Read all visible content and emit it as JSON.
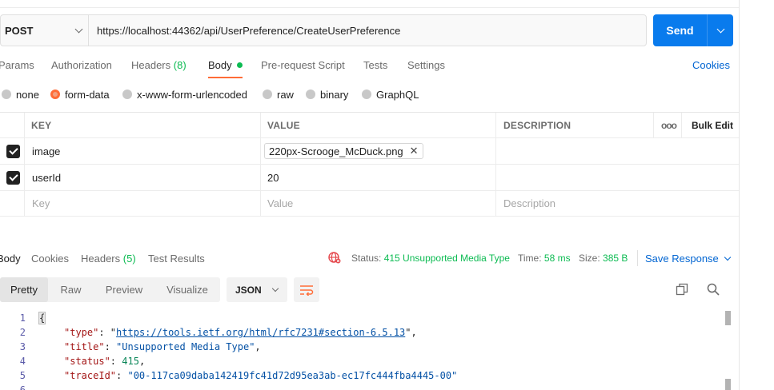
{
  "request": {
    "method": "POST",
    "url": "https://localhost:44362/api/UserPreference/CreateUserPreference",
    "send_label": "Send"
  },
  "request_tabs": {
    "params": "Params",
    "authorization": "Authorization",
    "headers": "Headers",
    "headers_count": "(8)",
    "body": "Body",
    "prerequest": "Pre-request Script",
    "tests": "Tests",
    "settings": "Settings",
    "cookies": "Cookies"
  },
  "body_types": {
    "none": "none",
    "form_data": "form-data",
    "urlencoded": "x-www-form-urlencoded",
    "raw": "raw",
    "binary": "binary",
    "graphql": "GraphQL",
    "selected": "form-data"
  },
  "form_table": {
    "headers": {
      "key": "KEY",
      "value": "VALUE",
      "description": "DESCRIPTION",
      "more": "ooo",
      "bulk_edit": "Bulk Edit"
    },
    "rows": [
      {
        "checked": true,
        "key": "image",
        "value": "220px-Scrooge_McDuck.png",
        "is_file": true
      },
      {
        "checked": true,
        "key": "userId",
        "value": "20",
        "is_file": false
      }
    ],
    "placeholder": {
      "key": "Key",
      "value": "Value",
      "description": "Description"
    }
  },
  "response_tabs": {
    "body": "Body",
    "cookies": "Cookies",
    "headers": "Headers",
    "headers_count": "(5)",
    "test_results": "Test Results"
  },
  "response_status": {
    "status_label": "Status:",
    "status_value": "415 Unsupported Media Type",
    "time_label": "Time:",
    "time_value": "58 ms",
    "size_label": "Size:",
    "size_value": "385 B",
    "save_response": "Save Response"
  },
  "response_view": {
    "modes": [
      "Pretty",
      "Raw",
      "Preview",
      "Visualize"
    ],
    "active_mode": "Pretty",
    "format": "JSON"
  },
  "response_body": {
    "line_numbers": [
      "1",
      "2",
      "3",
      "4",
      "5"
    ],
    "open_brace": "{",
    "type_key": "\"type\"",
    "type_value": "https://tools.ietf.org/html/rfc7231#section-6.5.13",
    "title_key": "\"title\"",
    "title_value": "\"Unsupported Media Type\"",
    "status_key": "\"status\"",
    "status_value": "415",
    "traceid_key": "\"traceId\"",
    "traceid_value": "\"00-117ca09daba142419fc41d72d95ea3ab-ec17fc444fba4445-00\""
  },
  "colors": {
    "accent_orange": "#ff6c37",
    "send_blue": "#097bed",
    "link_blue": "#0265d2",
    "count_green": "#0cbb52"
  }
}
